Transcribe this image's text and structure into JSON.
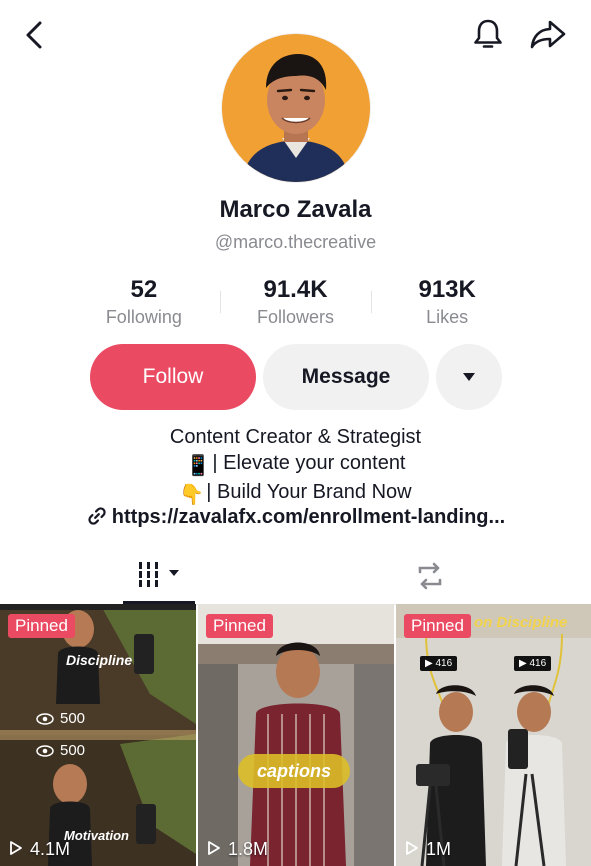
{
  "header": {
    "back_icon": "chevron-left-icon",
    "bell_icon": "bell-icon",
    "share_icon": "share-arrow-icon"
  },
  "profile": {
    "name": "Marco Zavala",
    "handle": "@marco.thecreative"
  },
  "stats": [
    {
      "value": "52",
      "label": "Following"
    },
    {
      "value": "91.4K",
      "label": "Followers"
    },
    {
      "value": "913K",
      "label": "Likes"
    }
  ],
  "actions": {
    "follow_label": "Follow",
    "message_label": "Message",
    "more_icon": "caret-down-icon"
  },
  "bio": {
    "line1": "Content Creator & Strategist",
    "line2_emoji": "📱",
    "line2_text": "| Elevate your content",
    "line3_emoji": "👇",
    "line3_text": "| Build Your Brand Now",
    "link": "https://zavalafx.com/enrollment-landing..."
  },
  "tabs": {
    "videos_icon": "grid-icon",
    "repost_icon": "repost-icon"
  },
  "videos": [
    {
      "pinned": "Pinned",
      "views": "4.1M",
      "overlay_top": "Discipline",
      "overlay_bottom": "Motivation",
      "eye1": "500",
      "eye2": "500"
    },
    {
      "pinned": "Pinned",
      "views": "1.8M",
      "caption": "captions"
    },
    {
      "pinned": "Pinned",
      "views": "1M",
      "overlay_top": "on Discipline",
      "badge1": "416",
      "badge2": "416"
    }
  ],
  "colors": {
    "accent": "#ea4b62",
    "muted": "#8a8b91",
    "button_gray": "#f1f1f2"
  }
}
